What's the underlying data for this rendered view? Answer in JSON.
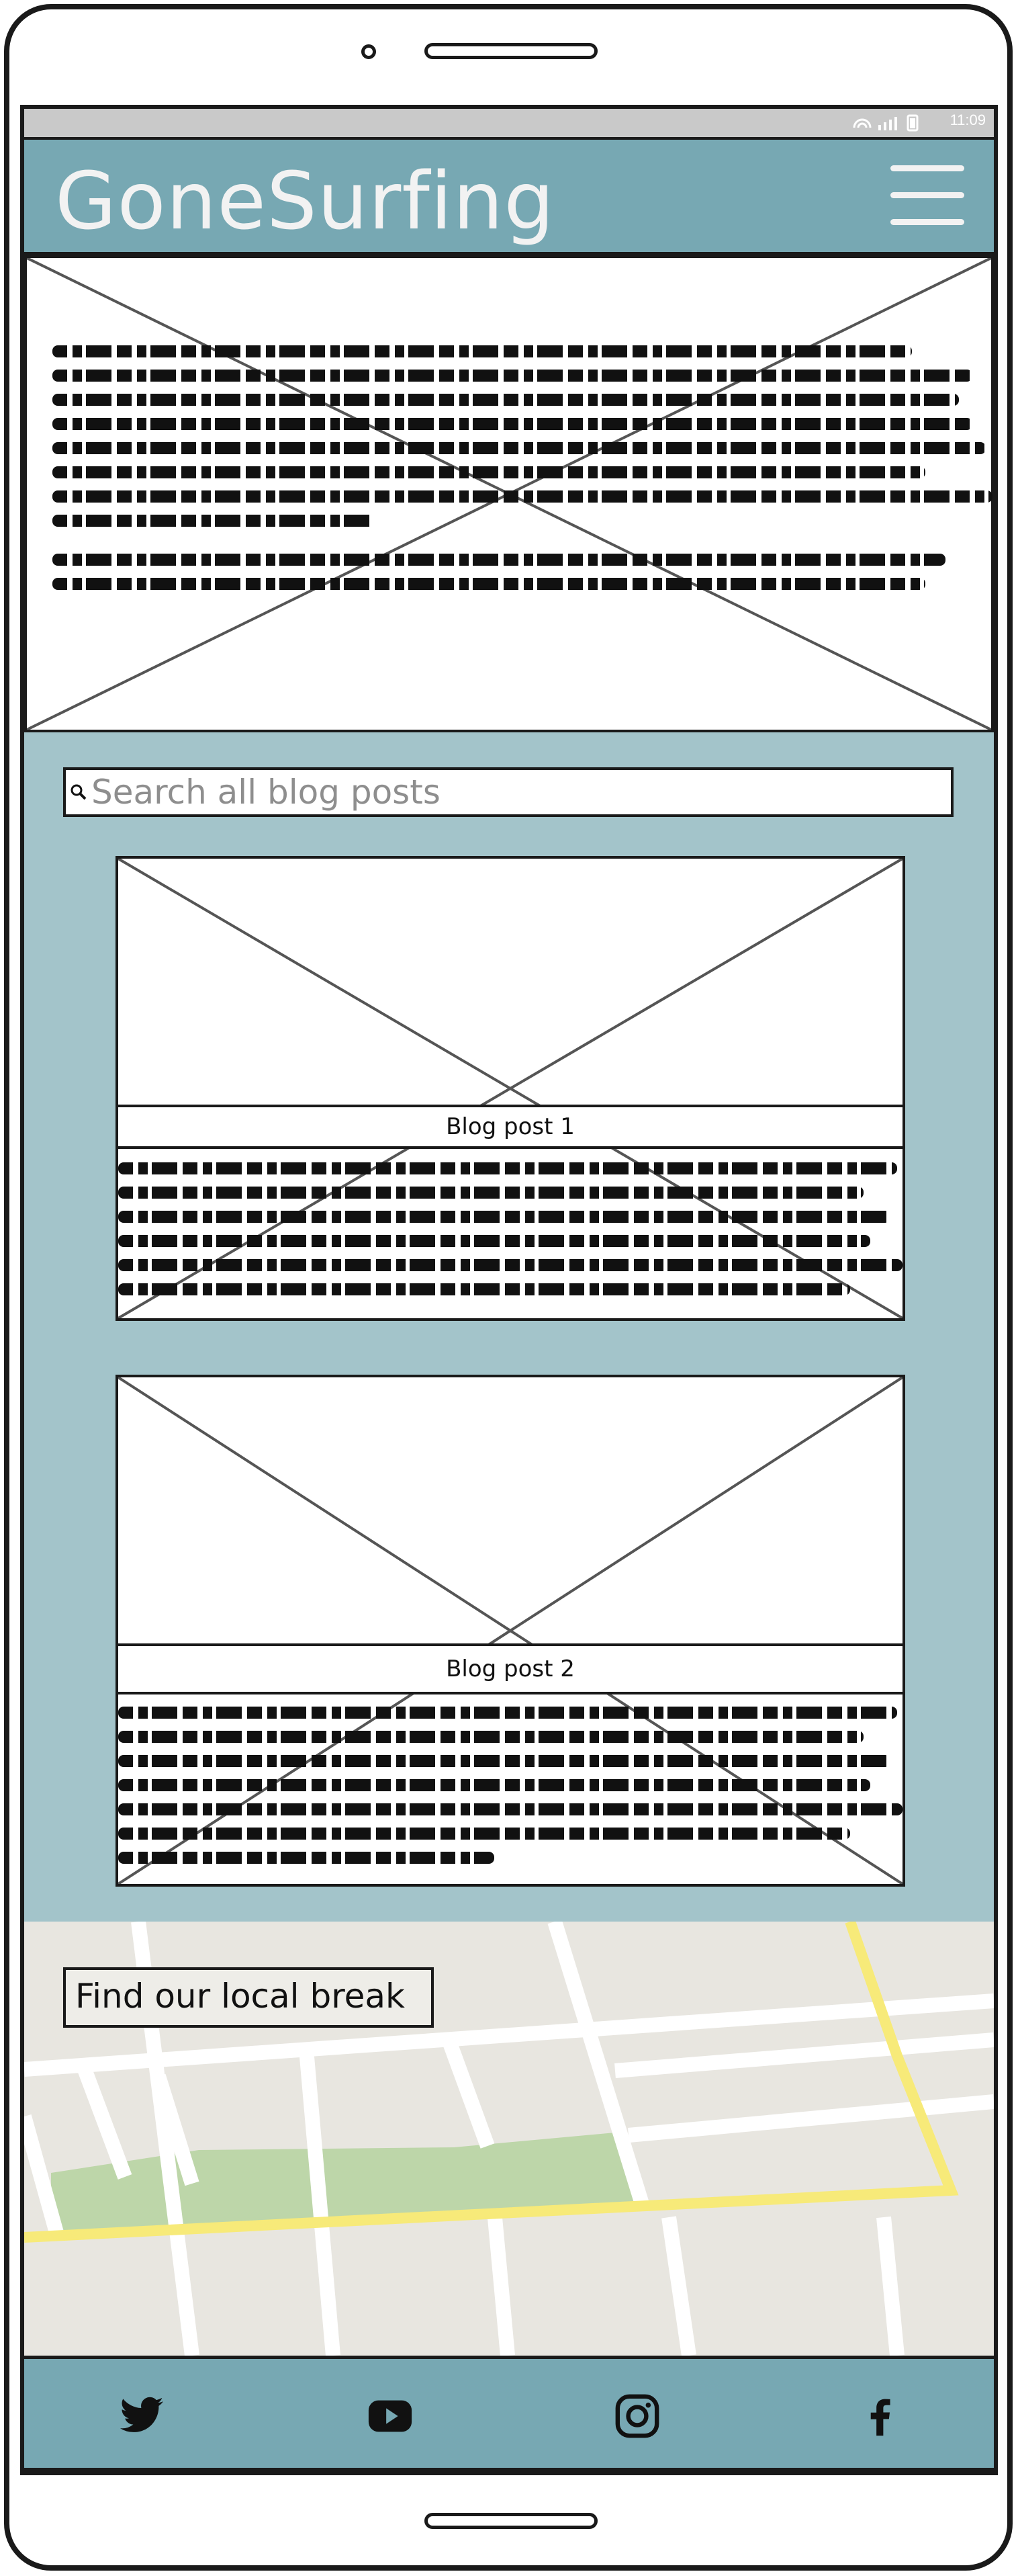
{
  "statusbar": {
    "time": "11:09"
  },
  "header": {
    "brand": "GoneSurfing",
    "menu_icon": "hamburger-menu-icon"
  },
  "search": {
    "placeholder": "Search all blog posts",
    "icon": "search-icon"
  },
  "posts": [
    {
      "title": "Blog post 1"
    },
    {
      "title": "Blog post 2"
    }
  ],
  "map": {
    "label": "Find our local break"
  },
  "footer": {
    "social": [
      {
        "name": "twitter",
        "icon": "twitter-icon"
      },
      {
        "name": "youtube",
        "icon": "youtube-icon"
      },
      {
        "name": "instagram",
        "icon": "instagram-icon"
      },
      {
        "name": "facebook",
        "icon": "facebook-icon"
      }
    ]
  },
  "colors": {
    "header": "#77a8b3",
    "content_bg": "#a3c4ca",
    "map_bg": "#e8e6e0",
    "map_road": "#ffffff",
    "map_highway": "#f7ea79",
    "map_park": "#bdd6a9"
  }
}
